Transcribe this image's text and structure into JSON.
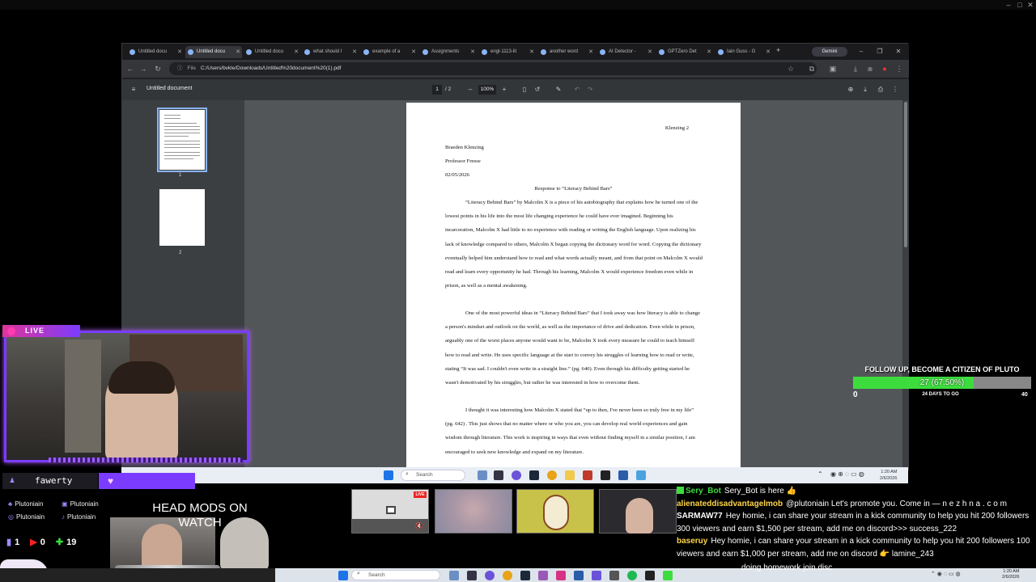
{
  "browser": {
    "tabs": [
      {
        "label": "Untitled docu"
      },
      {
        "label": "Untitled docu"
      },
      {
        "label": "Untitled docu"
      },
      {
        "label": "what should I"
      },
      {
        "label": "example of a"
      },
      {
        "label": "Assignments"
      },
      {
        "label": "engl-1113-lit"
      },
      {
        "label": "another word"
      },
      {
        "label": "AI Detector -"
      },
      {
        "label": "GPTZero Det"
      },
      {
        "label": "Iain Guss - G"
      }
    ],
    "gemini_label": "Gemini",
    "url_chip": "File",
    "url": "C:/Users/bvkle/Downloads/Untitled%20document%20(1).pdf"
  },
  "pdf": {
    "title": "Untitled document",
    "current_page": "1",
    "total_pages": "/  2",
    "zoom": "100%",
    "thumb1_num": "1",
    "thumb2_num": "2",
    "page": {
      "header_right": "Klenzing 2",
      "name": "Braeden Klenzing",
      "professor": "Professor Freese",
      "date": "02/05/2026",
      "title": "Response to “Literacy Behind Bars”",
      "para1": "“Literacy Behind Bars” by Malcolm X is a piece of his autobiography that explains how he turned one of the lowest points in his life into the most life changing experience he could have ever imagined. Beginning his incarceration, Malcolm X had little to no experience with reading or writing the English language. Upon realizing his lack of knowledge compared to others, Malcolm X began copying the dictionary word for word. Copying the dictionary eventually helped him understand how to read and what words actually meant, and from that point on Malcolm X would read and learn every opportunity he had. Through his learning, Malcolm X would experience freedom even while in prison, as well as a mental awakening.",
      "para2": "One of the most powerful ideas in “Literacy Behind Bars” that I took away was how literacy is able to change a person's mindset and outlook on the world, as well as the importance of drive and dedication. Even while in prison, arguably one of the worst places anyone would want to be, Malcolm X took every measure he could to teach himself how to read and write. He uses specific language at the start to convey his struggles of learning how to read or write, stating “It was sad. I couldn't even write in a straight line.” (pg. 640). Even through his difficulty getting started he wasn't demotivated by his struggles, but rather he was interested in how to overcome them.",
      "para3": "I thought it was interesting how Malcolm X stated that “up to then, I've never been so truly free in my life” (pg. 642) . This just shows that no matter where or who you are, you can develop real world experiences and gain wisdom through literature. This work is inspiring in ways that even without finding myself in a similar position, I am encouraged to seek new knowledge and expand on my literature."
    }
  },
  "inner_taskbar": {
    "search_placeholder": "Search",
    "time": "1:20 AM",
    "date": "2/6/2026"
  },
  "stream": {
    "live_label": "LIVE",
    "follower_name": "fawerty",
    "socials": [
      "Plutoniain",
      "Plutoniain",
      "Plutoniain",
      "Plutoniain"
    ],
    "stats": {
      "a": "1",
      "b": "0",
      "c": "19"
    },
    "mods_text": "HEAD MODS ON WATCH",
    "goal": {
      "title": "FOLLOW UP, BECOME A CITIZEN OF PLUTO",
      "value_text": "27 (67.50%)",
      "progress": 0.675,
      "min": "0",
      "max": "40",
      "days": "24 DAYS TO GO"
    },
    "guest_live": "LIVE"
  },
  "chat": [
    {
      "user": "Sery_Bot",
      "color": "#3ddc3d",
      "msg": "Sery_Bot is here 👍"
    },
    {
      "user": "alienateddisadvantagelmob",
      "color": "#ffd54a",
      "msg": "@plutoniain Let's promote you. Come in — n e z h n a . c o m"
    },
    {
      "user": "SARMAW77",
      "color": "#ffffff",
      "msg": "Hey homie, i can share your stream in a kick community to help you hit 200 followers 300 viewers and earn $1,500 per stream, add me on discord>>> success_222"
    },
    {
      "user": "baseruy",
      "color": "#ffd54a",
      "msg": "Hey homie, i can share your stream in a kick community to help you hit 200 followers 100 viewers and earn $1,000 per stream, add me on discord 👉 lamine_243"
    },
    {
      "user": "",
      "color": "#ffffff",
      "msg": "doing homework join disc"
    }
  ],
  "outer_taskbar": {
    "search_placeholder": "Search",
    "time": "1:20 AM",
    "date": "2/6/2026"
  }
}
